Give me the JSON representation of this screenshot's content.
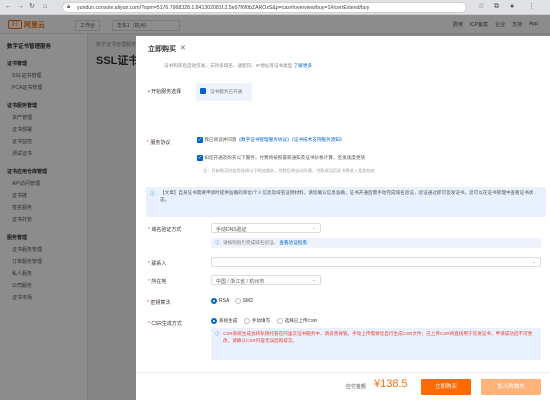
{
  "browser": {
    "url": "yundun.console.aliyun.com/?spm=5176.7968328.1.841302081f.2.5e97f6f0bZAROxS&p=cas#/overview/buy=1#/certExtend/buy",
    "back_icon": "arrow-left-icon",
    "forward_icon": "arrow-right-icon",
    "refresh_icon": "refresh-icon"
  },
  "topnav": {
    "logo_mark": "[-]",
    "logo_text": "阿里云",
    "workspace": "工作台",
    "region": "华东1（杭州）",
    "links": [
      "费用",
      "ICP备案",
      "企业",
      "支持",
      "App"
    ]
  },
  "sidebar": {
    "title": "数字证书管理服务",
    "items": [
      {
        "label": "证书管理",
        "group": true
      },
      {
        "label": "SSL证书管理",
        "group": false
      },
      {
        "label": "PCA证书管理",
        "group": false
      },
      {
        "label": "证书服务管理",
        "group": true
      },
      {
        "label": "资产管理",
        "group": false
      },
      {
        "label": "证书部署",
        "group": false
      },
      {
        "label": "证书监控",
        "group": false
      },
      {
        "label": "测试证书",
        "group": false
      },
      {
        "label": "证书应用仓库管理",
        "group": true
      },
      {
        "label": "API访问管理",
        "group": false
      },
      {
        "label": "证书链",
        "group": false
      },
      {
        "label": "签名服务",
        "group": false
      },
      {
        "label": "证书托管",
        "group": false
      },
      {
        "label": "服务管理",
        "group": true
      },
      {
        "label": "证书服务管理",
        "group": false
      },
      {
        "label": "订单服务管理",
        "group": false
      },
      {
        "label": "私人服务",
        "group": false
      },
      {
        "label": "公司服务",
        "group": false
      },
      {
        "label": "证书市场",
        "group": false
      }
    ]
  },
  "main": {
    "breadcrumb": "数字证书管理服务 / SSL证书",
    "title": "SSL证书"
  },
  "drawer": {
    "title": "立即购买",
    "close_icon": "close-icon",
    "tip": "证书购买后自动签发，支持多域名、通配符、IP地址等证书类型",
    "tip_link": "了解更多",
    "row_label_open": "开始服务选择",
    "open_tip": "证书服务已开通",
    "service_label": "服务协议",
    "agree1_text": "我已阅读并同意",
    "agree1_link": "《数字证书管理服务协议》《证书技术支持服务须知》",
    "agree2_text": "如您开通及购买以下服务，付费将按照最新通知及证书价格计算，签发速度更快",
    "agree_note": "注：开始购买时若您选择以下附加服务，付款后将自动开通，付款成功后证书将进入签发状态",
    "info_text": "【文章】自身证书需要申请时提供准确的单位/个人信息及域名证明材料，请您确认信息准确，证书开通后需手动完成域名验证，验证通过即可签发证书，您可以在证书管理中查看证书状态。",
    "domain_label": "域名验证方式",
    "domain_value": "手动DNS验证",
    "domain_hint": "请按照指引完成域名验证。",
    "domain_hint_link": "查看验证指南",
    "contact_label": "联系人",
    "contact_value": "",
    "location_label": "所在地",
    "location_value": "中国 / 浙江省 / 杭州市",
    "alg_label": "密钥算法",
    "alg_options": [
      "RSA",
      "SM2"
    ],
    "alg_selected": "RSA",
    "csr_label": "CSR生成方式",
    "csr_options": [
      "系统生成",
      "手动填写",
      "选择已上传CSR"
    ],
    "csr_selected": "系统生成",
    "csr_note": "CSR系统生成会将私钥托管在阿里云证书服务中，请妥善保管。手动上传需要您自行生成CSR文件；已上传CSR将直接用于签发证书，申请成功后不可更改，请确认CSR内容无误后再提交。",
    "price_label": "应付金额",
    "price": "¥138.5",
    "buy_button": "立即购买",
    "cart_button": "加入购物车"
  },
  "colors": {
    "brand": "#ff6a00",
    "primary": "#0064c8",
    "danger": "#e43"
  }
}
